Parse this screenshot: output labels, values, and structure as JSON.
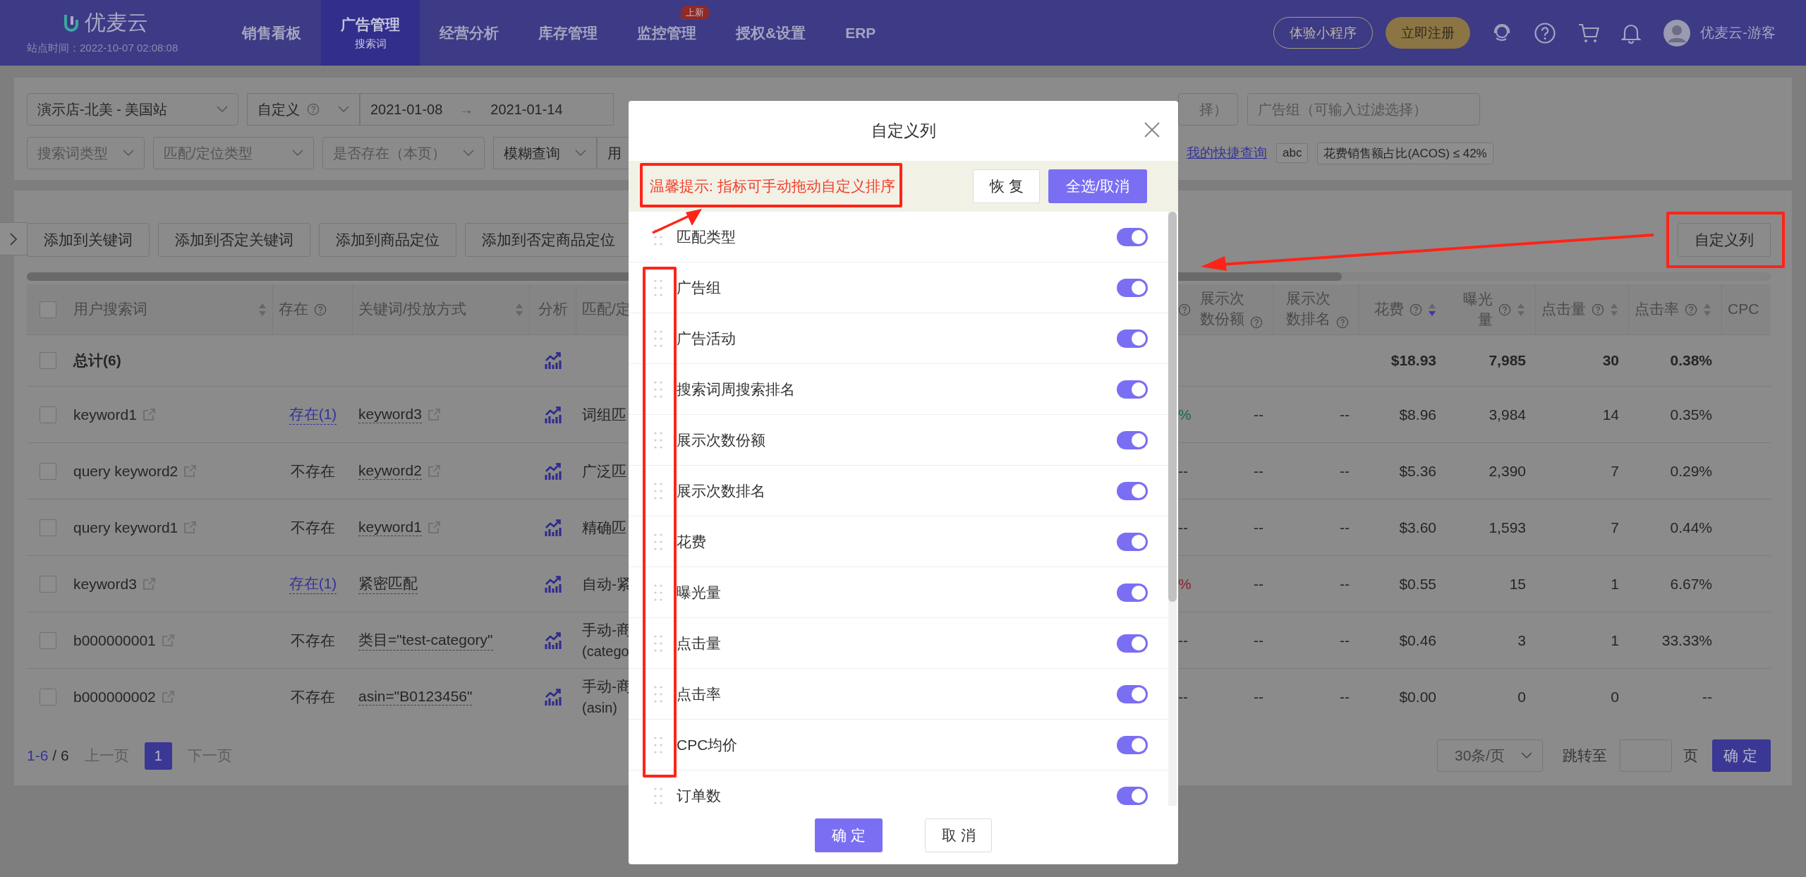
{
  "header": {
    "logo": "优麦云",
    "site_time": "站点时间：2022-10-07 02:08:08",
    "nav": [
      {
        "label": "销售看板",
        "selected": false
      },
      {
        "label": "广告管理",
        "sub": "搜索词",
        "selected": true
      },
      {
        "label": "经营分析",
        "selected": false
      },
      {
        "label": "库存管理",
        "selected": false
      },
      {
        "label": "监控管理",
        "badge": "上新",
        "selected": false
      },
      {
        "label": "授权&设置",
        "selected": false
      },
      {
        "label": "ERP",
        "selected": false
      }
    ],
    "trial_button": "体验小程序",
    "register_button": "立即注册",
    "user": "优麦云-游客"
  },
  "filters": {
    "row_1": [
      {
        "kind": "select",
        "value": "演示店-北美 - 美国站"
      },
      {
        "kind": "help_select",
        "value": "自定义"
      },
      {
        "kind": "date_range",
        "start": "2021-01-08",
        "separator": "→",
        "end": "2021-01-14"
      }
    ],
    "row_1_right": [
      {
        "kind": "input",
        "placeholder": "择）"
      },
      {
        "kind": "input",
        "placeholder": "广告组（可输入过滤选择）"
      }
    ],
    "row_2": [
      {
        "kind": "select",
        "placeholder": "搜索词类型"
      },
      {
        "kind": "select",
        "placeholder": "匹配/定位类型"
      },
      {
        "kind": "select",
        "placeholder": "是否存在（本页）"
      },
      {
        "kind": "select",
        "value": "模糊查询"
      },
      {
        "kind": "input",
        "value": "用"
      }
    ],
    "quick_query_link": "我的快捷查询",
    "tags": [
      "abc",
      "花费销售额占比(ACOS) ≤ 42%"
    ]
  },
  "toolbar": {
    "buttons": [
      "添加到关键词",
      "添加到否定关键词",
      "添加到商品定位",
      "添加到否定商品定位"
    ],
    "custom_columns_button": "自定义列"
  },
  "table": {
    "all_selected": false,
    "columns": [
      {
        "label": "用户搜索词",
        "sorted": false
      },
      {
        "label": "存在",
        "help": true
      },
      {
        "label": "关键词/投放方式",
        "sorted": false
      },
      {
        "label": "分析"
      },
      {
        "label": "匹配/定"
      },
      {
        "help": true
      },
      {
        "label": "展示次数份额",
        "help": true
      },
      {
        "label": "展示次数排名",
        "help": true
      },
      {
        "label": "花费",
        "help": true,
        "sorted": true
      },
      {
        "label": "曝光量",
        "help": true,
        "sorted": false
      },
      {
        "label": "点击量",
        "help": true,
        "sorted": false
      },
      {
        "label": "点击率",
        "help": true,
        "sorted": false
      },
      {
        "label": "CPC"
      }
    ],
    "total": {
      "label": "总计(6)",
      "selected": false,
      "spend": "$18.93",
      "impressions": "7,985",
      "clicks": "30",
      "ctr": "0.38%"
    },
    "rows": [
      {
        "selected": false,
        "search_term": "keyword1",
        "exists": {
          "text": "存在(1)",
          "linked": true
        },
        "keyword": {
          "text": "keyword3",
          "icon": true
        },
        "match": {
          "text": "词组匹"
        },
        "column_6": {
          "text": "%",
          "color": "#1a6b44"
        },
        "impression_share": "--",
        "impression_rank": "--",
        "spend": "$8.96",
        "impressions": "3,984",
        "clicks": "14",
        "ctr": "0.35%"
      },
      {
        "selected": false,
        "search_term": "query keyword2",
        "exists": {
          "text": "不存在",
          "linked": false
        },
        "keyword": {
          "text": "keyword2",
          "icon": true
        },
        "match": {
          "text": "广泛匹"
        },
        "column_6": {
          "text": "--",
          "color": "#262626"
        },
        "impression_share": "--",
        "impression_rank": "--",
        "spend": "$5.36",
        "impressions": "2,390",
        "clicks": "7",
        "ctr": "0.29%"
      },
      {
        "selected": false,
        "search_term": "query keyword1",
        "exists": {
          "text": "不存在",
          "linked": false
        },
        "keyword": {
          "text": "keyword1",
          "icon": true
        },
        "match": {
          "text": "精确匹"
        },
        "column_6": {
          "text": "--",
          "color": "#262626"
        },
        "impression_share": "--",
        "impression_rank": "--",
        "spend": "$3.60",
        "impressions": "1,593",
        "clicks": "7",
        "ctr": "0.44%"
      },
      {
        "selected": false,
        "search_term": "keyword3",
        "exists": {
          "text": "存在(1)",
          "linked": true
        },
        "keyword": {
          "text": "紧密匹配",
          "icon": false
        },
        "match": {
          "text": "自动-紧"
        },
        "column_6": {
          "text": "%",
          "color": "#8a1f2e"
        },
        "impression_share": "--",
        "impression_rank": "--",
        "spend": "$0.55",
        "impressions": "15",
        "clicks": "1",
        "ctr": "6.67%"
      },
      {
        "selected": false,
        "search_term": "b000000001",
        "exists": {
          "text": "不存在",
          "linked": false
        },
        "keyword": {
          "text": "类目=\"test-category\"",
          "icon": false
        },
        "match": {
          "text": "手动-商",
          "note": "(catego"
        },
        "column_6": {
          "text": "--",
          "color": "#262626"
        },
        "impression_share": "--",
        "impression_rank": "--",
        "spend": "$0.46",
        "impressions": "3",
        "clicks": "1",
        "ctr": "33.33%"
      },
      {
        "selected": false,
        "search_term": "b000000002",
        "exists": {
          "text": "不存在",
          "linked": false
        },
        "keyword": {
          "text": "asin=\"B0123456\"",
          "icon": false
        },
        "match": {
          "text": "手动-商",
          "note": "(asin)"
        },
        "column_6": {
          "text": "--",
          "color": "#262626"
        },
        "impression_share": "--",
        "impression_rank": "--",
        "spend": "$0.00",
        "impressions": "0",
        "clicks": "0",
        "ctr": "--"
      }
    ]
  },
  "pagination": {
    "range": "1-6",
    "total": "/ 6",
    "prev": "上一页",
    "pages": [
      {
        "label": "1",
        "selected": true
      }
    ],
    "next": "下一页",
    "page_size": "30条/页",
    "jump_label": "跳转至",
    "page_unit": "页",
    "go_button": "确定"
  },
  "modal": {
    "title": "自定义列",
    "tip": "温馨提示: 指标可手动拖动自定义排序",
    "reset_button": "恢复",
    "select_all_button": "全选/取消",
    "items": [
      {
        "label": "匹配类型",
        "on": true
      },
      {
        "label": "广告组",
        "on": true
      },
      {
        "label": "广告活动",
        "on": true
      },
      {
        "label": "搜索词周搜索排名",
        "on": true
      },
      {
        "label": "展示次数份额",
        "on": true
      },
      {
        "label": "展示次数排名",
        "on": true
      },
      {
        "label": "花费",
        "on": true
      },
      {
        "label": "曝光量",
        "on": true
      },
      {
        "label": "点击量",
        "on": true
      },
      {
        "label": "点击率",
        "on": true
      },
      {
        "label": "CPC均价",
        "on": true
      },
      {
        "label": "订单数",
        "on": true
      }
    ],
    "ok_button": "确定",
    "cancel_button": "取消"
  }
}
